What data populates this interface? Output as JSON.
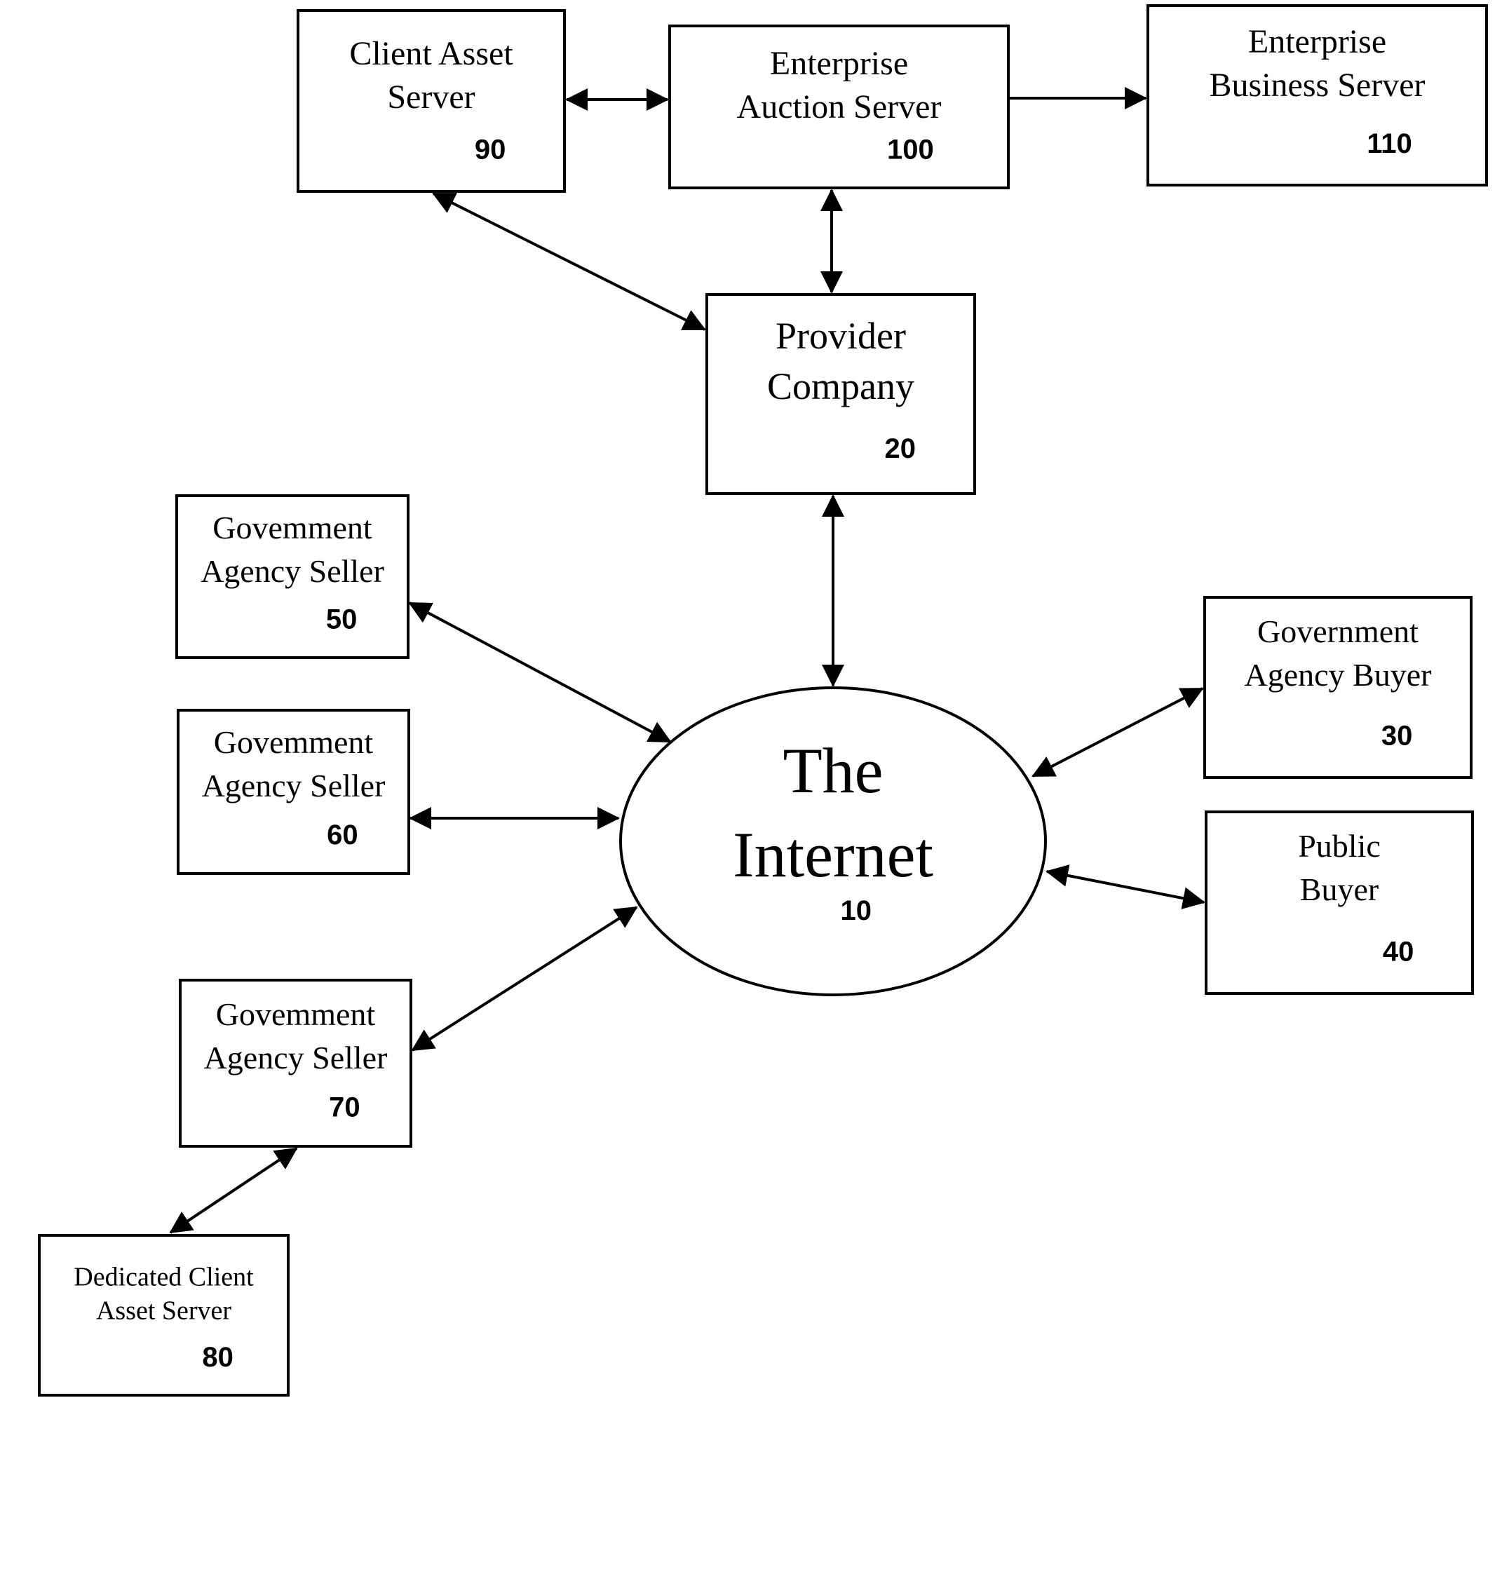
{
  "diagram": {
    "type": "network-block-diagram",
    "nodes": [
      {
        "id": "internet",
        "shape": "ellipse",
        "lines": [
          "The",
          "Internet"
        ],
        "ref": "10"
      },
      {
        "id": "provider-company",
        "shape": "box",
        "lines": [
          "Provider",
          "Company"
        ],
        "ref": "20"
      },
      {
        "id": "gov-agency-buyer",
        "shape": "box",
        "lines": [
          "Government",
          "Agency Buyer"
        ],
        "ref": "30"
      },
      {
        "id": "public-buyer",
        "shape": "box",
        "lines": [
          "Public",
          "Buyer"
        ],
        "ref": "40"
      },
      {
        "id": "gov-agency-seller-50",
        "shape": "box",
        "lines": [
          "Govemment",
          "Agency Seller"
        ],
        "ref": "50"
      },
      {
        "id": "gov-agency-seller-60",
        "shape": "box",
        "lines": [
          "Govemment",
          "Agency Seller"
        ],
        "ref": "60"
      },
      {
        "id": "gov-agency-seller-70",
        "shape": "box",
        "lines": [
          "Govemment",
          "Agency Seller"
        ],
        "ref": "70"
      },
      {
        "id": "dedicated-client-asset-server",
        "shape": "box",
        "lines": [
          "Dedicated Client",
          "Asset Server"
        ],
        "ref": "80"
      },
      {
        "id": "client-asset-server",
        "shape": "box",
        "lines": [
          "Client Asset",
          "Server"
        ],
        "ref": "90"
      },
      {
        "id": "enterprise-auction-server",
        "shape": "box",
        "lines": [
          "Enterprise",
          "Auction Server"
        ],
        "ref": "100"
      },
      {
        "id": "enterprise-business-server",
        "shape": "box",
        "lines": [
          "Enterprise",
          "Business Server"
        ],
        "ref": "110"
      }
    ],
    "edges": [
      {
        "from": "client-asset-server",
        "to": "enterprise-auction-server",
        "direction": "both"
      },
      {
        "from": "enterprise-auction-server",
        "to": "enterprise-business-server",
        "direction": "forward"
      },
      {
        "from": "enterprise-auction-server",
        "to": "provider-company",
        "direction": "both"
      },
      {
        "from": "client-asset-server",
        "to": "provider-company",
        "direction": "both"
      },
      {
        "from": "provider-company",
        "to": "internet",
        "direction": "both"
      },
      {
        "from": "gov-agency-seller-50",
        "to": "internet",
        "direction": "both"
      },
      {
        "from": "gov-agency-seller-60",
        "to": "internet",
        "direction": "both"
      },
      {
        "from": "gov-agency-seller-70",
        "to": "internet",
        "direction": "both"
      },
      {
        "from": "gov-agency-seller-70",
        "to": "dedicated-client-asset-server",
        "direction": "both"
      },
      {
        "from": "internet",
        "to": "gov-agency-buyer",
        "direction": "both"
      },
      {
        "from": "internet",
        "to": "public-buyer",
        "direction": "both"
      }
    ]
  }
}
